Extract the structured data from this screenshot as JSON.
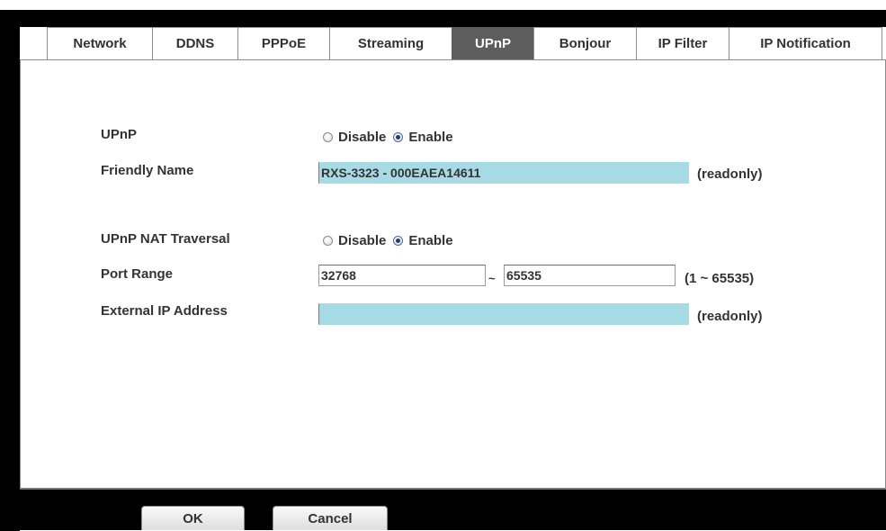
{
  "tabs": [
    {
      "label": "Network"
    },
    {
      "label": "DDNS"
    },
    {
      "label": "PPPoE"
    },
    {
      "label": "Streaming"
    },
    {
      "label": "UPnP",
      "active": true
    },
    {
      "label": "Bonjour"
    },
    {
      "label": "IP Filter"
    },
    {
      "label": "IP Notification"
    }
  ],
  "form": {
    "upnp": {
      "label": "UPnP",
      "disable_label": "Disable",
      "enable_label": "Enable",
      "selected": "Enable"
    },
    "friendly_name": {
      "label": "Friendly Name",
      "value": "RXS-3323 - 000EAEA14611",
      "note": "(readonly)"
    },
    "nat_traversal": {
      "label": "UPnP NAT Traversal",
      "disable_label": "Disable",
      "enable_label": "Enable",
      "selected": "Enable"
    },
    "port_range": {
      "label": "Port Range",
      "from": "32768",
      "separator": "~",
      "to": "65535",
      "note": "(1 ~ 65535)"
    },
    "external_ip": {
      "label": "External IP Address",
      "value": "",
      "note": "(readonly)"
    }
  },
  "buttons": {
    "ok": "OK",
    "cancel": "Cancel"
  },
  "colors": {
    "readonly_field": "#a6dbe6",
    "active_tab": "#5d5d5d",
    "frame": "#000000"
  }
}
